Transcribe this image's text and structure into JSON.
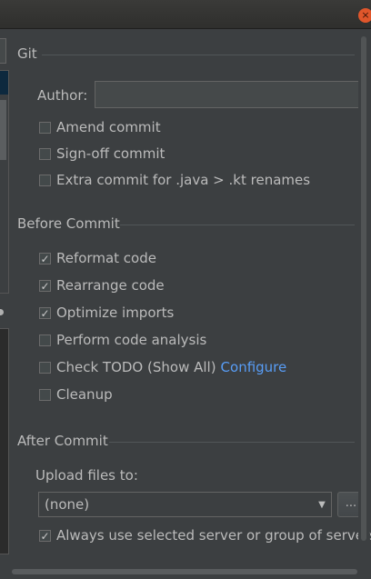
{
  "window": {
    "close_glyph": "×"
  },
  "git": {
    "title": "Git",
    "author_label": "Author:",
    "author_value": "",
    "options": [
      {
        "label": "Amend commit",
        "checked": false
      },
      {
        "label": "Sign-off commit",
        "checked": false
      },
      {
        "label": "Extra commit for .java > .kt renames",
        "checked": false
      }
    ]
  },
  "before_commit": {
    "title": "Before Commit",
    "options": [
      {
        "label": "Reformat code",
        "checked": true
      },
      {
        "label": "Rearrange code",
        "checked": true
      },
      {
        "label": "Optimize imports",
        "checked": true
      },
      {
        "label": "Perform code analysis",
        "checked": false
      },
      {
        "label": "Check TODO (Show All)",
        "checked": false,
        "link": "Configure"
      },
      {
        "label": "Cleanup",
        "checked": false
      }
    ]
  },
  "after_commit": {
    "title": "After Commit",
    "upload_label": "Upload files to:",
    "upload_value": "(none)",
    "browse_label": "...",
    "always_use": {
      "label": "Always use selected server or group of servers",
      "checked": true
    }
  },
  "colors": {
    "background": "#3c3f41",
    "text": "#bbbbbb",
    "link": "#589df6",
    "close": "#e0562b"
  }
}
